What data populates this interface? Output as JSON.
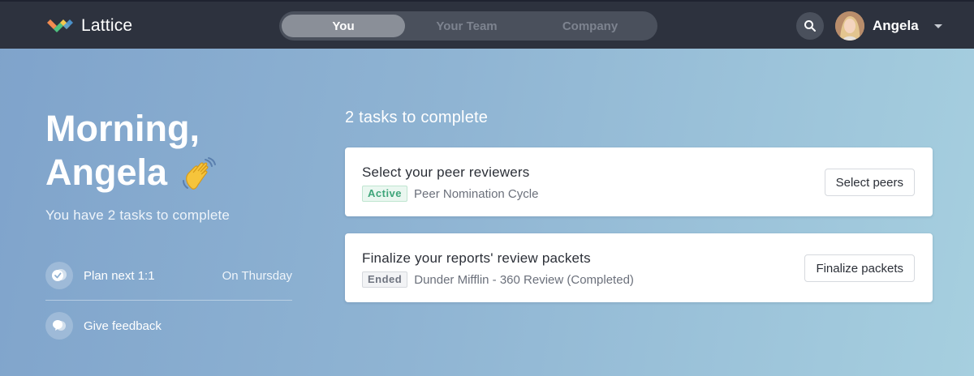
{
  "app": {
    "name": "Lattice"
  },
  "nav": {
    "tabs": [
      {
        "label": "You",
        "active": true
      },
      {
        "label": "Your Team",
        "active": false
      },
      {
        "label": "Company",
        "active": false
      }
    ],
    "search_icon": "search-icon",
    "user": {
      "name": "Angela"
    }
  },
  "greeting": {
    "line1": "Morning,",
    "line2": "Angela",
    "emoji": "waving-hand-icon",
    "subtitle": "You have 2 tasks to complete"
  },
  "sidebar": {
    "items": [
      {
        "label": "Plan next 1:1",
        "meta": "On Thursday",
        "icon": "check-bubble-icon"
      },
      {
        "label": "Give feedback",
        "meta": "",
        "icon": "feedback-bubble-icon"
      }
    ]
  },
  "tasks": {
    "heading": "2 tasks to complete",
    "items": [
      {
        "title": "Select your peer reviewers",
        "status": "Active",
        "cycle": "Peer Nomination Cycle",
        "action": "Select peers"
      },
      {
        "title": "Finalize your reports' review packets",
        "status": "Ended",
        "cycle": "Dunder Mifflin - 360 Review (Completed)",
        "action": "Finalize packets"
      }
    ]
  },
  "colors": {
    "topbar": "#2d323e",
    "active_badge": "#3fa57a",
    "ended_badge": "#6f7480",
    "logo_green": "#4fc17f",
    "logo_orange": "#f28b50",
    "logo_yellow": "#f4c94e",
    "logo_blue": "#4f9bd8"
  }
}
